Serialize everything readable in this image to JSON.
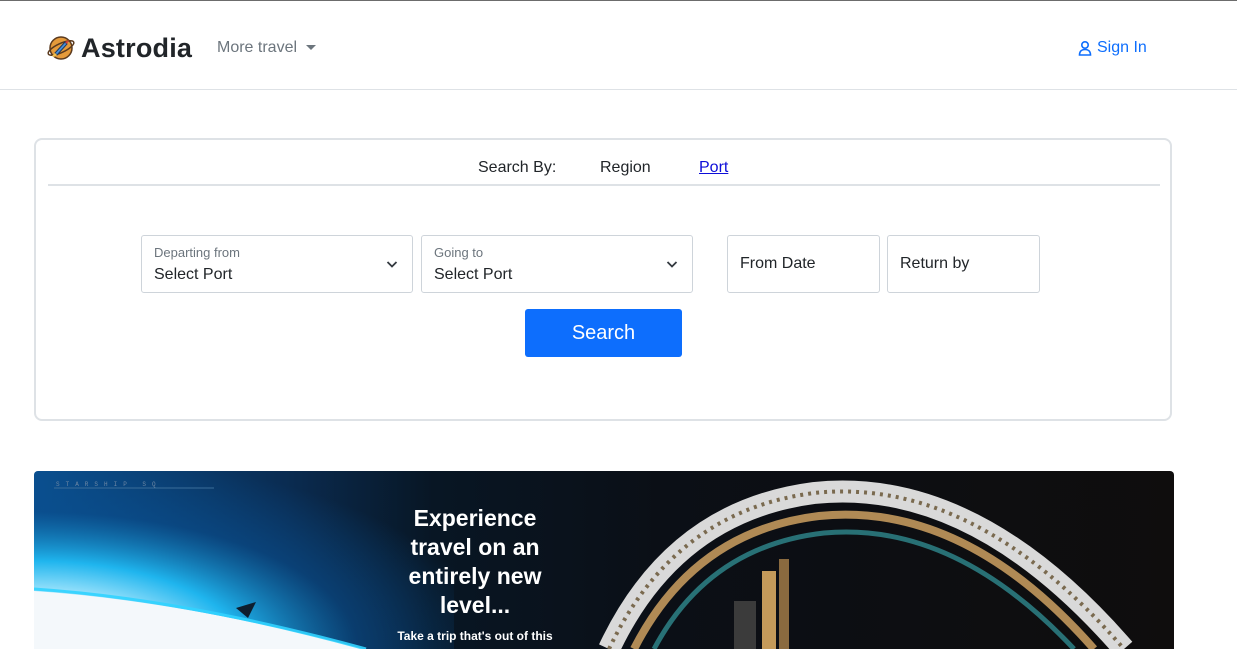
{
  "navbar": {
    "brand_name": "Astrodia",
    "brand_icon": "rocket-planet-icon",
    "more_travel_label": "More travel",
    "signin_label": "Sign In",
    "signin_icon": "user-icon",
    "accent_color": "#0d6efd"
  },
  "search": {
    "search_by_label": "Search By:",
    "tabs": [
      {
        "label": "Region",
        "active": false
      },
      {
        "label": "Port",
        "active": true
      }
    ],
    "departing": {
      "label": "Departing from",
      "value": "Select Port"
    },
    "going": {
      "label": "Going to",
      "value": "Select Port"
    },
    "from_date": {
      "placeholder": "From Date"
    },
    "return_by": {
      "placeholder": "Return by"
    },
    "search_button_label": "Search"
  },
  "hero": {
    "tag": "STARSHIP SQ",
    "headline": "Experience travel on an entirely new level...",
    "subtext": "Take a trip that's out of this"
  }
}
